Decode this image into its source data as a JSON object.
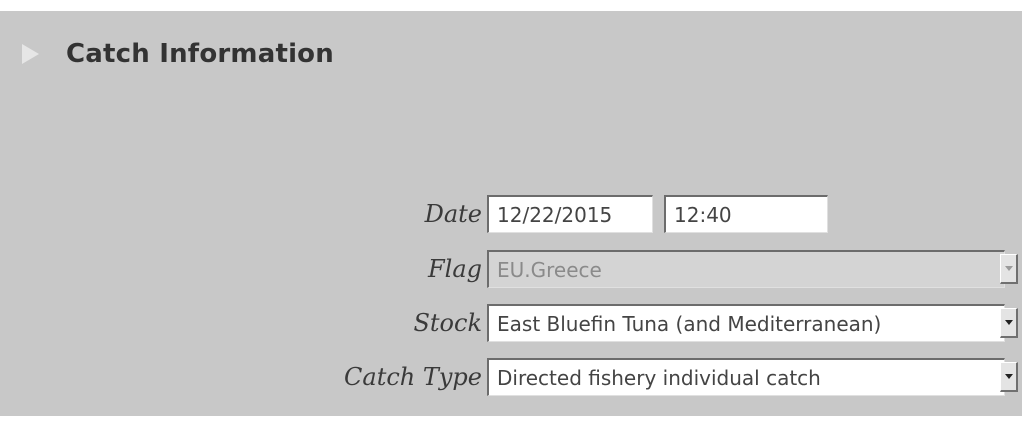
{
  "section": {
    "title": "Catch Information",
    "expand_icon": "triangle-right-icon"
  },
  "form": {
    "date": {
      "label": "Date",
      "date_value": "12/22/2015",
      "time_value": "12:40"
    },
    "flag": {
      "label": "Flag",
      "value": "EU.Greece",
      "disabled": true
    },
    "stock": {
      "label": "Stock",
      "value": "East Bluefin Tuna (and Mediterranean)"
    },
    "catch_type": {
      "label": "Catch Type",
      "value": "Directed fishery individual catch"
    }
  },
  "colors": {
    "panel_background": "#c8c8c8",
    "disabled_field": "#d4d4d4",
    "input_background": "#ffffff"
  }
}
